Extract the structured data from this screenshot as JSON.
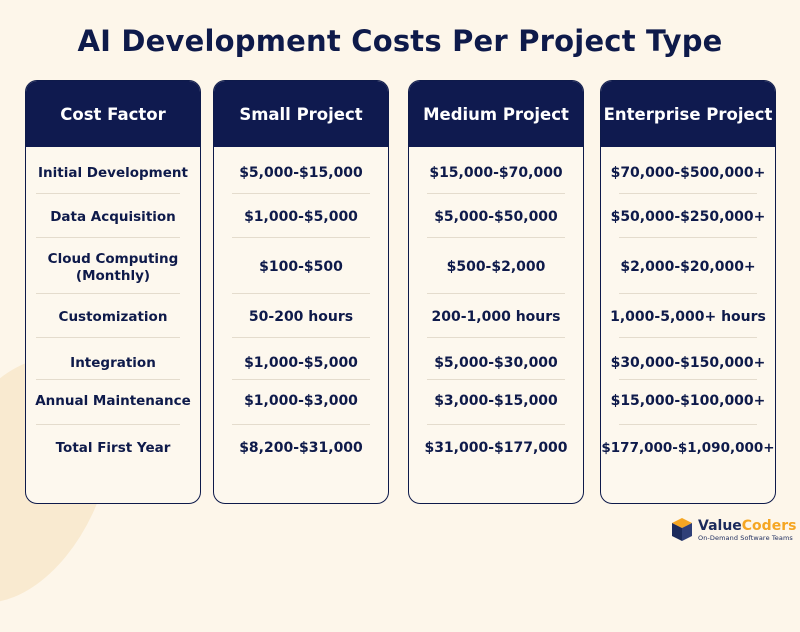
{
  "title": "AI Development Costs Per Project Type",
  "columns": [
    {
      "header": "Cost Factor",
      "cells": [
        "Initial Development",
        "Data Acquisition",
        "Cloud Computing\n(Monthly)",
        "Customization",
        "Integration",
        "Annual Maintenance",
        "Total First Year"
      ]
    },
    {
      "header": "Small Project",
      "cells": [
        "$5,000-$15,000",
        "$1,000-$5,000",
        "$100-$500",
        "50-200 hours",
        "$1,000-$5,000",
        "$1,000-$3,000",
        "$8,200-$31,000"
      ]
    },
    {
      "header": "Medium Project",
      "cells": [
        "$15,000-$70,000",
        "$5,000-$50,000",
        "$500-$2,000",
        "200-1,000 hours",
        "$5,000-$30,000",
        "$3,000-$15,000",
        "$31,000-$177,000"
      ]
    },
    {
      "header": "Enterprise Project",
      "cells": [
        "$70,000-$500,000+",
        "$50,000-$250,000+",
        "$2,000-$20,000+",
        "1,000-5,000+ hours",
        "$30,000-$150,000+",
        "$15,000-$100,000+",
        "$177,000-$1,090,000+"
      ]
    }
  ],
  "logo": {
    "name_part1": "Value",
    "name_part2": "Coders",
    "tagline": "On-Demand Software Teams"
  },
  "colors": {
    "header_bg": "#0f1a4f",
    "accent": "#f5a623",
    "background": "#fdf6ea"
  }
}
